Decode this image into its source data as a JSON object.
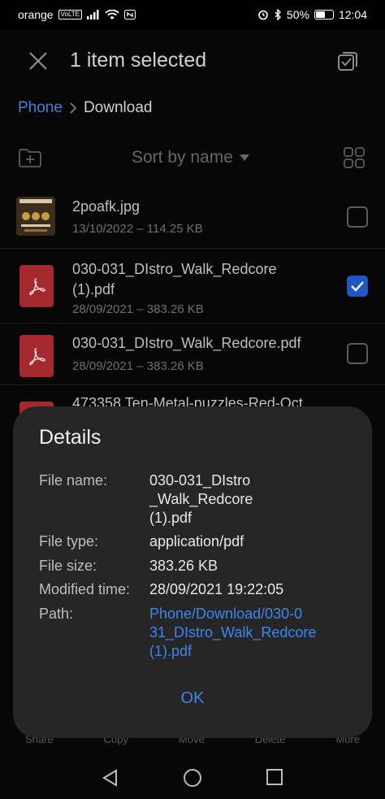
{
  "status_bar": {
    "carrier": "orange",
    "volte": "VoLTE",
    "battery": "50%",
    "battery_level": 0.5,
    "time": "12:04"
  },
  "header": {
    "title": "1 item selected"
  },
  "breadcrumb": {
    "root": "Phone",
    "current": "Download"
  },
  "toolbar": {
    "sort_label": "Sort by name"
  },
  "files": [
    {
      "name": "2poafk.jpg",
      "meta": "13/10/2022 – 114.25 KB",
      "checked": false
    },
    {
      "name_line1": "030-031_DIstro_Walk_Redcore",
      "name_line2": "(1).pdf",
      "meta": "28/09/2021 – 383.26 KB",
      "checked": true
    },
    {
      "name": "030-031_DIstro_Walk_Redcore.pdf",
      "meta": "28/09/2021 – 383.26 KB",
      "checked": false
    },
    {
      "name": "473358 Ten-Metal-puzzles-Red-Oct",
      "checked": false
    }
  ],
  "bottom_actions": [
    "Share",
    "Copy",
    "Move",
    "Delete",
    "More"
  ],
  "dialog": {
    "title": "Details",
    "file_name_label": "File name:",
    "file_name_value": [
      "030-031_DIstro",
      "_Walk_Redcore",
      "(1).pdf"
    ],
    "file_type_label": "File type:",
    "file_type_value": "application/pdf",
    "file_size_label": "File size:",
    "file_size_value": "383.26 KB",
    "modified_label": "Modified time:",
    "modified_value": "28/09/2021 19:22:05",
    "path_label": "Path:",
    "path_value": [
      "Phone/Download/030-0",
      "31_DIstro_Walk_Redcore",
      "(1).pdf"
    ],
    "ok_label": "OK"
  },
  "colors": {
    "accent": "#3a86f0",
    "checkbox_checked": "#1f57c7",
    "pdf_red": "#a3292e",
    "dialog_bg": "#262626"
  }
}
